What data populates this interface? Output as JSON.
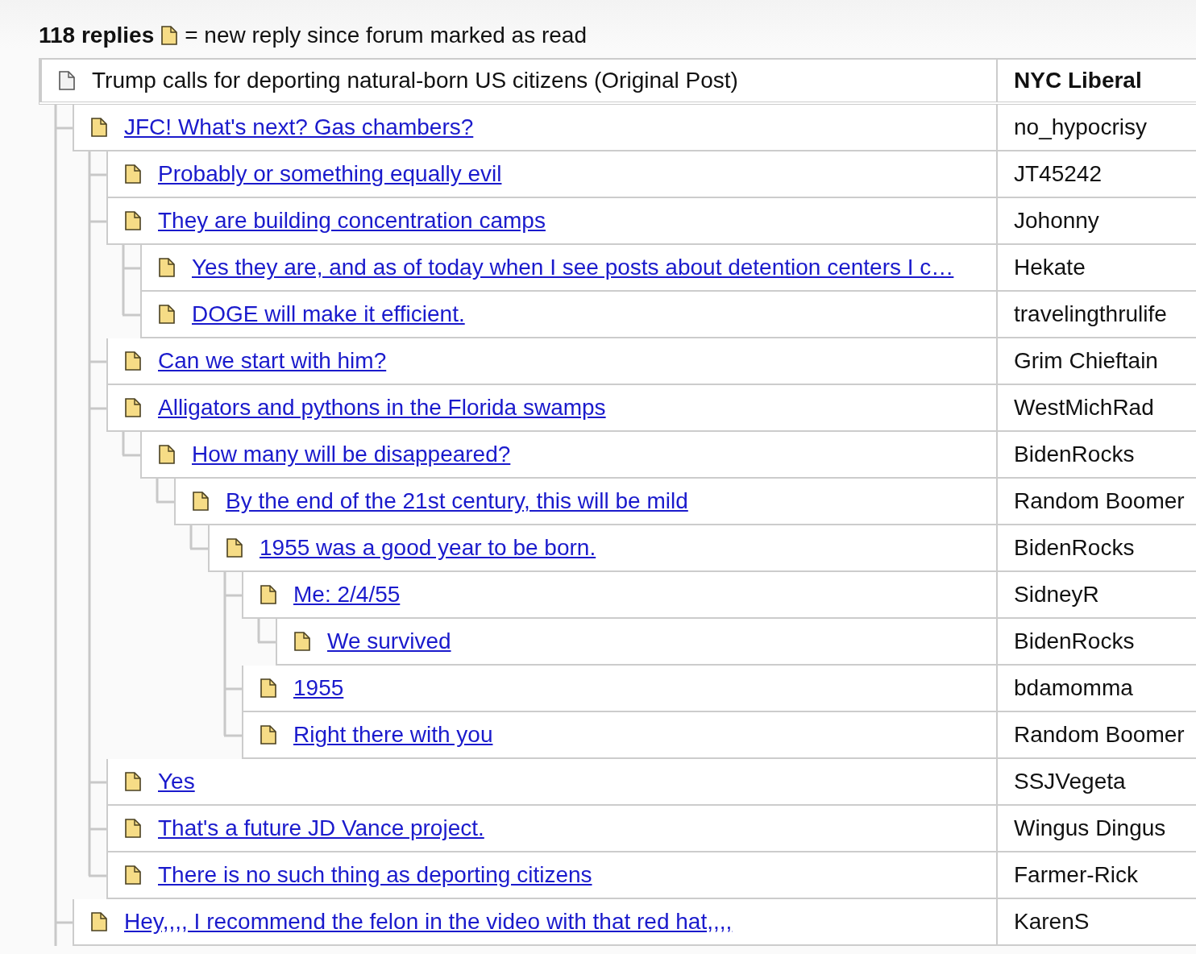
{
  "header": {
    "reply_count": "118 replies",
    "legend": "= new reply since forum marked as read"
  },
  "thread": {
    "subject": "Trump calls for deporting natural-born US citizens (Original Post)",
    "author": "NYC Liberal",
    "new": false,
    "replies": [
      {
        "subject": "JFC! What's next? Gas chambers?",
        "author": "no_hypocrisy",
        "new": true,
        "children": [
          {
            "subject": "Probably or something equally evil",
            "author": "JT45242",
            "new": true
          },
          {
            "subject": "They are building concentration camps",
            "author": "Johonny",
            "new": true,
            "children": [
              {
                "subject": "Yes they are, and as of today when I see posts about detention centers I c…",
                "author": "Hekate",
                "new": true
              },
              {
                "subject": "DOGE will make it efficient.",
                "author": "travelingthrulife",
                "new": true
              }
            ]
          },
          {
            "subject": "Can we start with him?",
            "author": "Grim Chieftain",
            "new": true
          },
          {
            "subject": "Alligators and pythons in the Florida swamps",
            "author": "WestMichRad",
            "new": true,
            "children": [
              {
                "subject": "How many will be disappeared?",
                "author": "BidenRocks",
                "new": true,
                "children": [
                  {
                    "subject": "By the end of the 21st century, this will be mild",
                    "author": "Random Boomer",
                    "new": true,
                    "children": [
                      {
                        "subject": "1955 was a good year to be born.",
                        "author": "BidenRocks",
                        "new": true,
                        "children": [
                          {
                            "subject": "Me: 2/4/55",
                            "author": "SidneyR",
                            "new": true,
                            "children": [
                              {
                                "subject": "We survived",
                                "author": "BidenRocks",
                                "new": true
                              }
                            ]
                          },
                          {
                            "subject": "1955",
                            "author": "bdamomma",
                            "new": true
                          },
                          {
                            "subject": "Right there with you",
                            "author": "Random Boomer",
                            "new": true
                          }
                        ]
                      }
                    ]
                  }
                ]
              }
            ]
          },
          {
            "subject": "Yes",
            "author": "SSJVegeta",
            "new": true
          },
          {
            "subject": "That's a future JD Vance project.",
            "author": "Wingus Dingus",
            "new": true
          },
          {
            "subject": "There is no such thing as deporting citizens",
            "author": "Farmer-Rick",
            "new": true
          }
        ]
      },
      {
        "subject": "Hey,,,, I recommend the felon in the video with that red hat,,,,",
        "author": "KarenS",
        "new": true
      }
    ]
  }
}
